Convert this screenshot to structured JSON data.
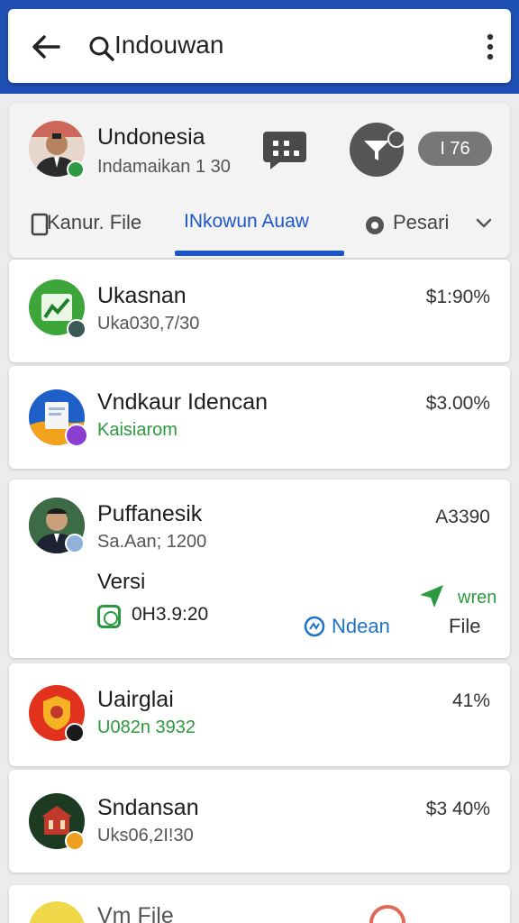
{
  "search": {
    "query": "Indouwan"
  },
  "profile": {
    "name": "Undonesia",
    "subtitle": "Indamaikan 1 30",
    "count": "I 76"
  },
  "tabs": [
    {
      "label": "Kanur. File"
    },
    {
      "label": "INkowun Auaw"
    },
    {
      "label": "Pesari"
    }
  ],
  "rows": [
    {
      "title": "Ukasnan",
      "subtitle": "Uka030,7/30",
      "amount": "$1:90%"
    },
    {
      "title": "Vndkaur Idencan",
      "subtitle": "Kaisiarom",
      "amount": "$3.00%"
    },
    {
      "title": "Puffanesik",
      "subtitle": "Sa.Aan; 1200",
      "amount": "A3390",
      "label": "Versi",
      "code": "0H3.9:20",
      "link": "Ndean",
      "action": "wren",
      "file": "File"
    },
    {
      "title": "Uairglai",
      "subtitle": "U082n 3932",
      "amount": "41%"
    },
    {
      "title": "Sndansan",
      "subtitle": "Uks06,2I!30",
      "amount": "$3 40%"
    },
    {
      "title": "Vm File"
    }
  ],
  "colors": {
    "brand_blue": "#1e4fb3",
    "accent_blue": "#1e56c8",
    "green": "#2b9a3e",
    "link_blue": "#1a73c8"
  }
}
